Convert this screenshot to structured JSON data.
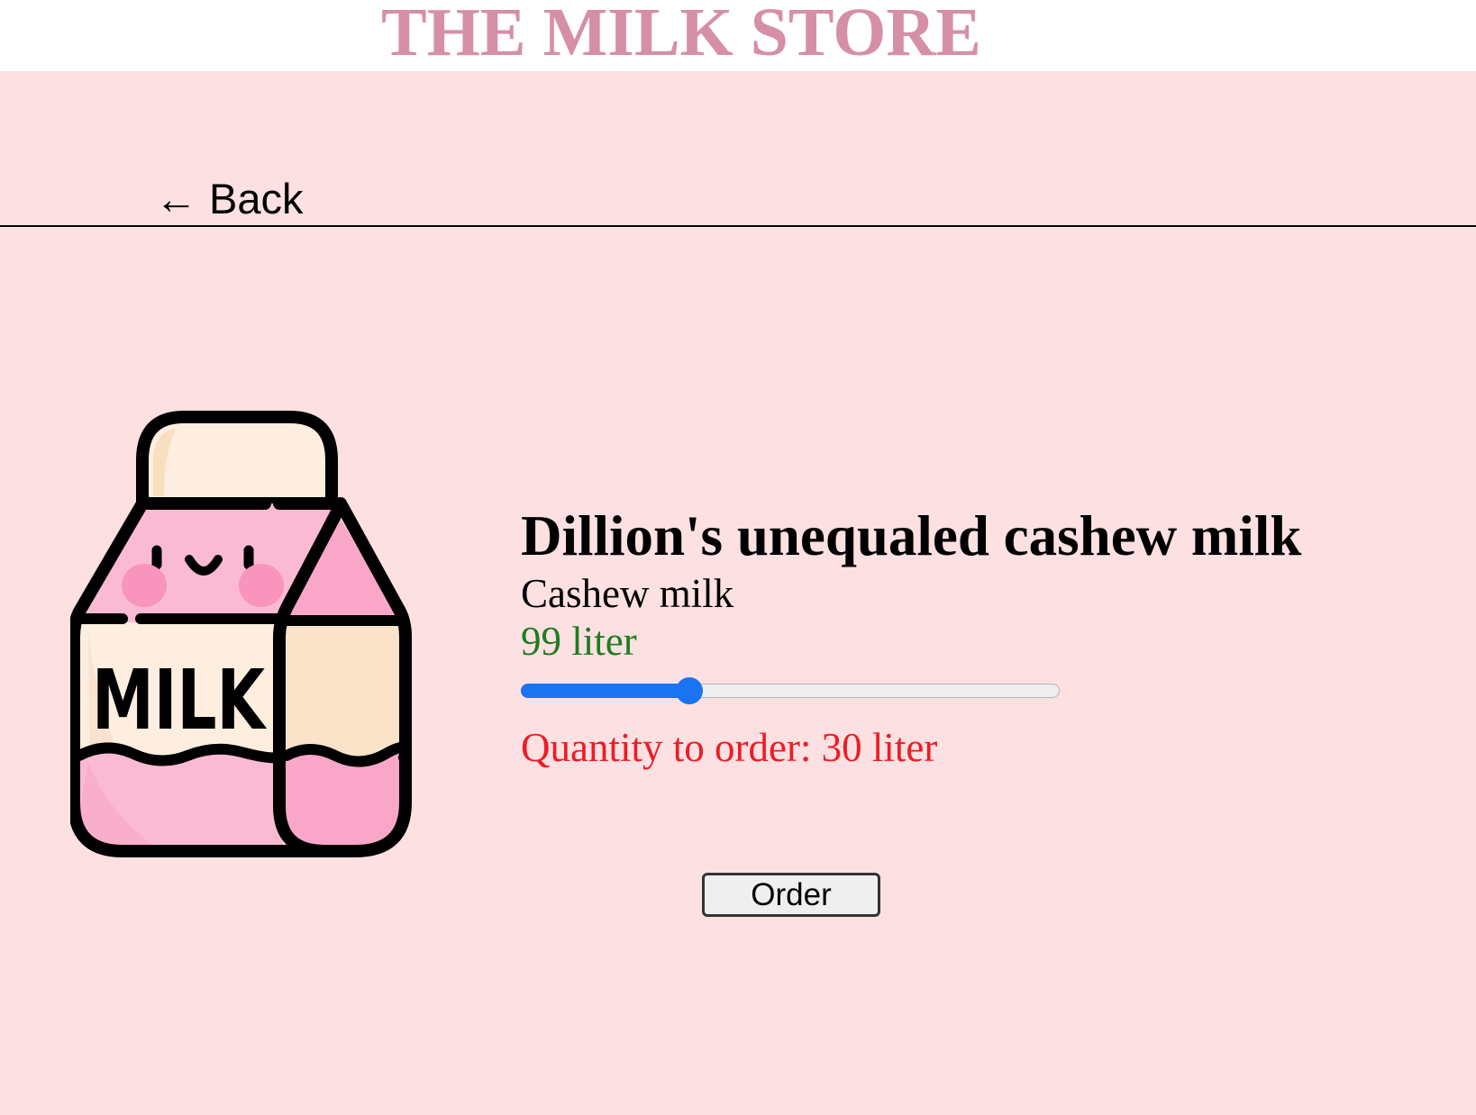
{
  "header": {
    "title": "THE MILK STORE"
  },
  "nav": {
    "back_label": "← Back"
  },
  "product": {
    "image_icon": "milk-carton-icon",
    "image_text": "MILK",
    "name": "Dillion's unequaled cashew milk",
    "type": "Cashew milk",
    "stock": "99 liter",
    "quantity_label": "Quantity to order: 30 liter",
    "slider": {
      "min": 0,
      "max": 99,
      "value": 30
    },
    "order_label": "Order"
  },
  "colors": {
    "page_background": "#fde0e2",
    "header_background": "#ffffff",
    "title": "#d68fa8",
    "stock_text": "#1e7d1e",
    "quantity_text": "#ee1c25",
    "slider_accent": "#1a73f0",
    "carton_pink": "#fbbad3",
    "carton_pink_dark": "#faa6c9",
    "carton_cream": "#fdeee0",
    "carton_beige": "#fbe3c9",
    "cheek": "#f994bd",
    "outline": "#000000"
  }
}
